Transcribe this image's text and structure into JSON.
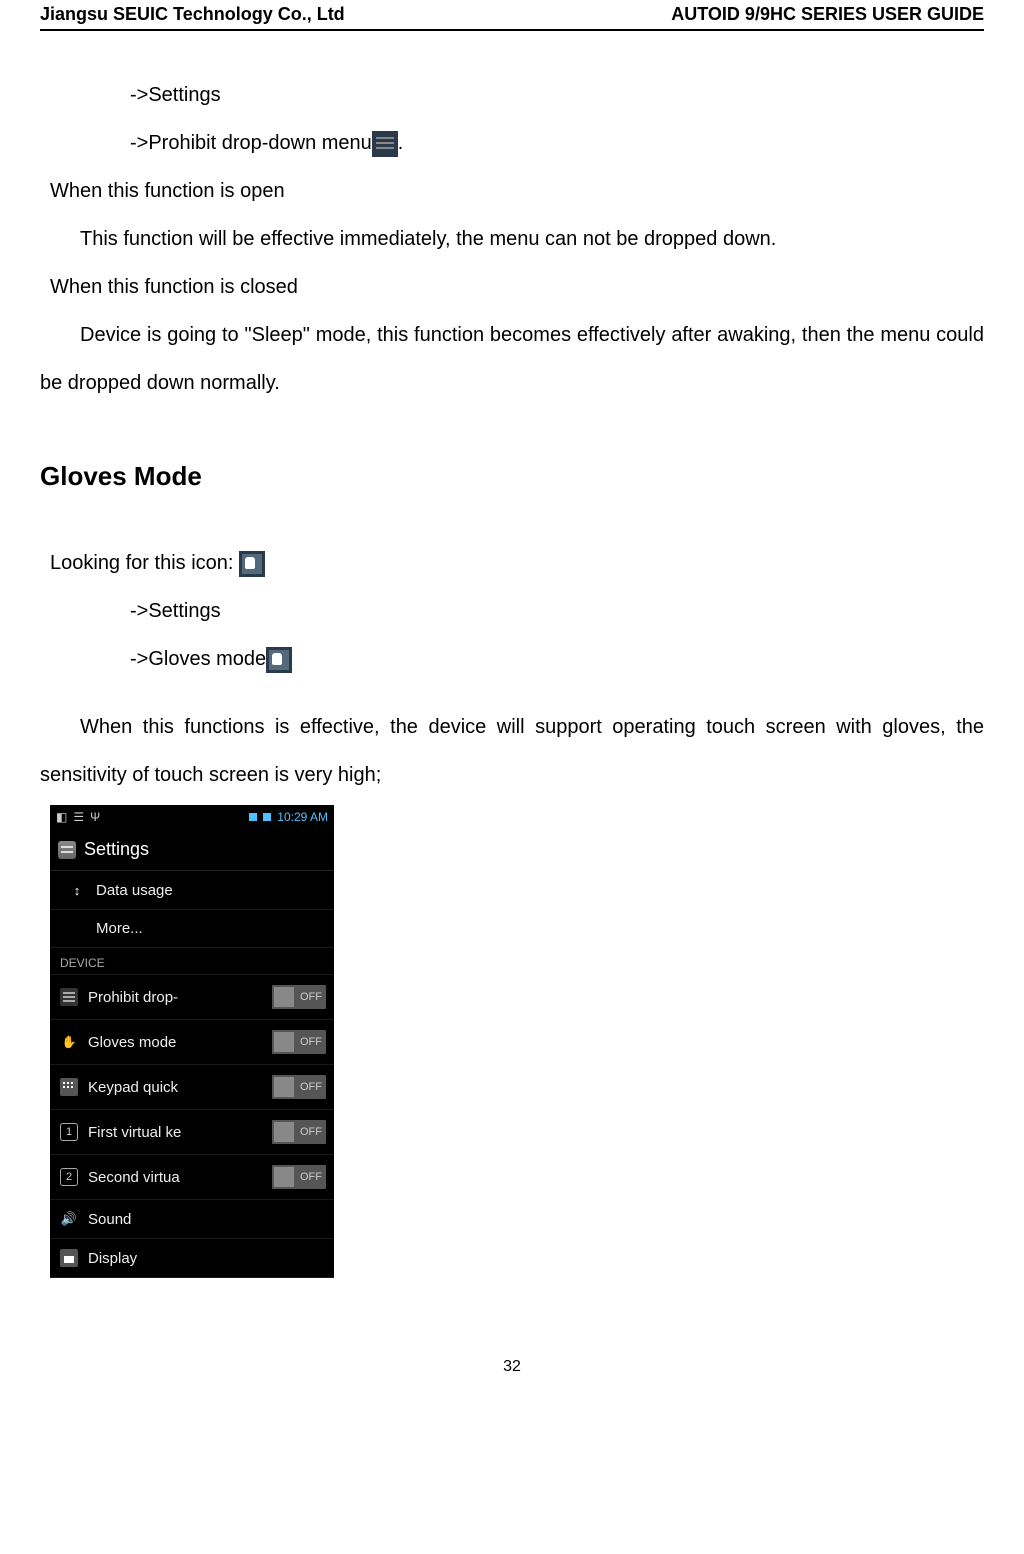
{
  "header": {
    "left": "Jiangsu SEUIC Technology Co., Ltd",
    "right": "AUTOID 9/9HC SERIES USER GUIDE"
  },
  "body": {
    "l1": "->Settings",
    "l2": "->Prohibit drop-down menu",
    "l3": "When this function is open",
    "l4": "This function will be effective immediately, the menu can not be dropped down.",
    "l5": "When this function is closed",
    "l6": "Device is going to \"Sleep\" mode, this function becomes effectively after awaking, then the menu could be dropped down normally.",
    "section_title": "Gloves Mode",
    "l7": "Looking for this icon: ",
    "l8": "->Settings",
    "l9": "->Gloves mode",
    "l10": "When this functions is effective, the device will support operating touch screen with gloves, the sensitivity of touch screen is very high;"
  },
  "screenshot": {
    "statusbar": {
      "time": "10:29 AM"
    },
    "title": "Settings",
    "items": {
      "data_usage": "Data usage",
      "more": "More...",
      "section_device": "DEVICE",
      "prohibit": "Prohibit drop-",
      "gloves": "Gloves mode",
      "keypad": "Keypad quick",
      "first_virtual": "First virtual ke",
      "second_virtual": "Second virtua",
      "sound": "Sound",
      "display": "Display"
    },
    "toggle_label": "OFF"
  },
  "footer": {
    "page_number": "32"
  }
}
